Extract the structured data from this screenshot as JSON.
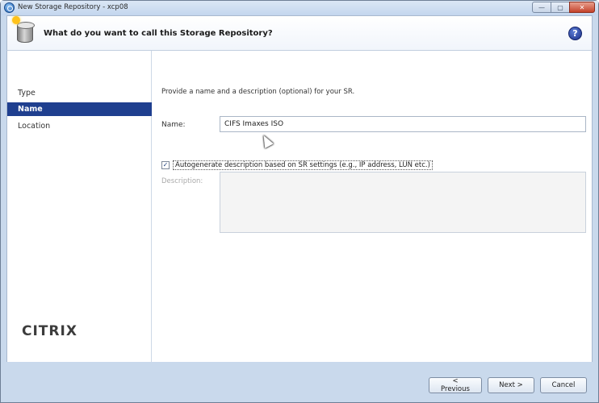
{
  "window": {
    "title": "New Storage Repository - xcp08",
    "controls": {
      "minimize": "—",
      "restore": "▢",
      "close": "✕"
    }
  },
  "header": {
    "title": "What do you want to call this Storage Repository?",
    "help": "?"
  },
  "sidebar": {
    "items": [
      {
        "label": "Type",
        "active": false
      },
      {
        "label": "Name",
        "active": true
      },
      {
        "label": "Location",
        "active": false
      }
    ],
    "logo": "CITRIX"
  },
  "main": {
    "intro": "Provide a name and a description (optional) for your SR.",
    "name_label": "Name:",
    "name_value": "CIFS Imaxes ISO",
    "autogen_checked": true,
    "autogen_label": "Autogenerate description based on SR settings (e.g., IP address, LUN etc.)",
    "description_label": "Description:",
    "description_value": ""
  },
  "footer": {
    "previous": "< Previous",
    "next": "Next >",
    "cancel": "Cancel"
  },
  "colors": {
    "selection": "#1f3f8f",
    "frame": "#c9d9ec"
  },
  "icons": [
    "storage-repository-icon",
    "help-icon",
    "app-icon",
    "mouse-cursor-icon"
  ]
}
